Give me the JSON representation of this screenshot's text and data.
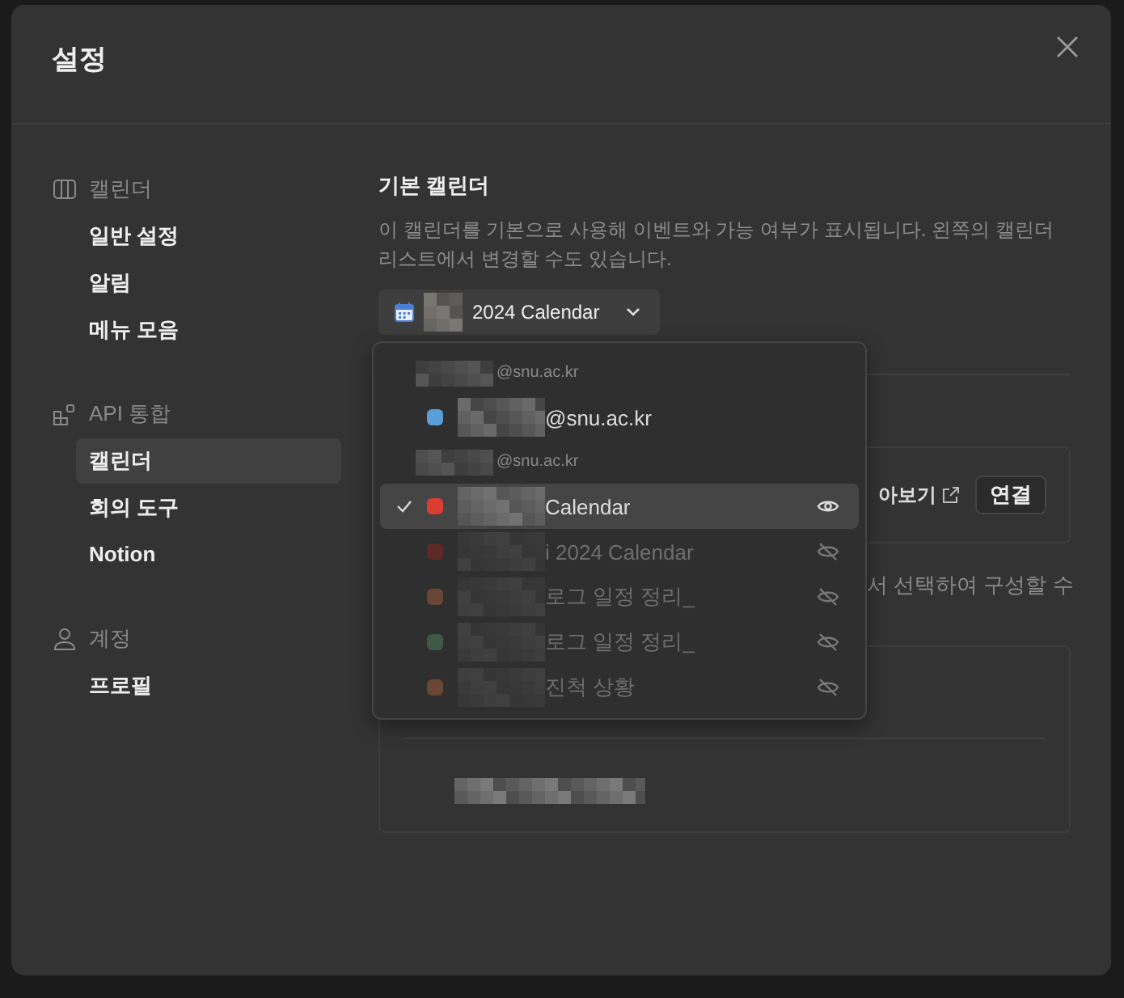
{
  "dialog": {
    "title": "설정"
  },
  "sidebar": [
    {
      "header": "캘린더",
      "items": [
        {
          "label": "일반 설정",
          "selected": false
        },
        {
          "label": "알림",
          "selected": false
        },
        {
          "label": "메뉴 모음",
          "selected": false
        }
      ]
    },
    {
      "header": "API 통합",
      "items": [
        {
          "label": "캘린더",
          "selected": true
        },
        {
          "label": "회의 도구",
          "selected": false
        },
        {
          "label": "Notion",
          "selected": false
        }
      ]
    },
    {
      "header": "계정",
      "items": [
        {
          "label": "프로필",
          "selected": false
        }
      ]
    }
  ],
  "default_calendar": {
    "heading": "기본 캘린더",
    "description": "이 캘린더를 기본으로 사용해 이벤트와 가능 여부가 표시됩니다. 왼쪽의 캘린더 리스트에서 변경할 수도 있습니다.",
    "selected_calendar": "2024 Calendar"
  },
  "dropdown": [
    {
      "kind": "account",
      "label": "@snu.ac.kr"
    },
    {
      "kind": "primary",
      "label": "@snu.ac.kr",
      "color": "#5b9fd9",
      "selected": false
    },
    {
      "kind": "account",
      "label": "@snu.ac.kr"
    },
    {
      "kind": "calendar",
      "label": "Calendar",
      "color": "#dc3c32",
      "selected": true,
      "visible": true
    },
    {
      "kind": "calendar",
      "label": "i 2024 Calendar",
      "color": "#5e2a28",
      "selected": false,
      "visible": false
    },
    {
      "kind": "calendar",
      "label": "로그 일정 정리_",
      "color": "#6a4636",
      "selected": false,
      "visible": false
    },
    {
      "kind": "calendar",
      "label": "로그 일정 정리_",
      "color": "#3e5a46",
      "selected": false,
      "visible": false
    },
    {
      "kind": "calendar",
      "label": "진척 상황",
      "color": "#6a4636",
      "selected": false,
      "visible": false
    }
  ],
  "integration_card": {
    "link": "아보기",
    "button": "연결"
  },
  "hint": "서 선택하여 구성할 수"
}
